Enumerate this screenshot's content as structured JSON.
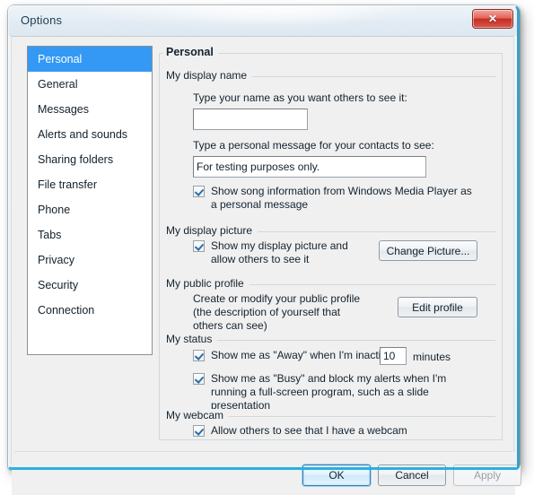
{
  "window": {
    "title": "Options",
    "close_icon": "close-icon",
    "close_glyph": "✕"
  },
  "sidebar": {
    "items": [
      {
        "label": "Personal",
        "selected": true
      },
      {
        "label": "General",
        "selected": false
      },
      {
        "label": "Messages",
        "selected": false
      },
      {
        "label": "Alerts and sounds",
        "selected": false
      },
      {
        "label": "Sharing  folders",
        "selected": false
      },
      {
        "label": "File transfer",
        "selected": false
      },
      {
        "label": "Phone",
        "selected": false
      },
      {
        "label": "Tabs",
        "selected": false
      },
      {
        "label": "Privacy",
        "selected": false
      },
      {
        "label": "Security",
        "selected": false
      },
      {
        "label": "Connection",
        "selected": false
      }
    ]
  },
  "pane": {
    "title": "Personal",
    "groups": {
      "display_name": {
        "label": "My  display  name",
        "name_prompt": "Type your name as you want others to see it:",
        "name_value": "",
        "name_placeholder": "",
        "message_prompt": "Type a personal message for your contacts to see:",
        "message_value": "For testing purposes only.",
        "song_checkbox": {
          "label": "Show song information from Windows Media Player as a personal message",
          "checked": true
        }
      },
      "display_picture": {
        "label": "My  display  picture",
        "checkbox": {
          "label": "Show my display picture and allow others to see it",
          "checked": true
        },
        "button": "Change Picture..."
      },
      "public_profile": {
        "label": "My  public  profile",
        "description": "Create or modify your public profile (the description of yourself that others can see)",
        "button": "Edit profile"
      },
      "status": {
        "label": "My  status",
        "away_checkbox": {
          "label_before": "Show me as \"Away\" when I'm inactive :",
          "checked": true
        },
        "away_minutes": "10",
        "minutes_suffix": "minutes",
        "busy_checkbox": {
          "label": "Show me as \"Busy\" and block my alerts when I'm running a full-screen program, such as a slide presentation",
          "checked": true
        }
      },
      "webcam": {
        "label": "My  webcam",
        "checkbox": {
          "label": "Allow others to see that I have a webcam",
          "checked": true
        }
      }
    }
  },
  "footer": {
    "ok": "OK",
    "cancel": "Cancel",
    "apply": "Apply"
  },
  "colors": {
    "selection_blue": "#3399f4",
    "close_red": "#c62c22",
    "aero_rim": "#29b0e0",
    "check_blue": "#2a6fa8"
  }
}
